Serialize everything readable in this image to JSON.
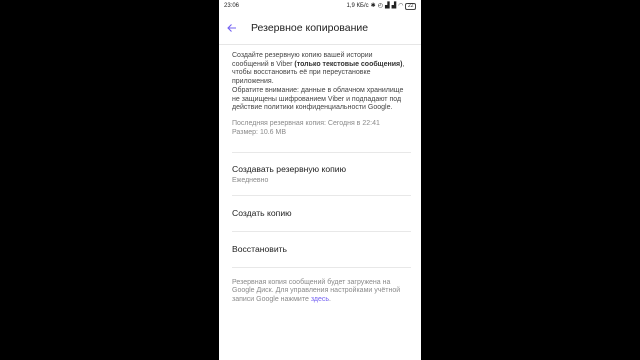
{
  "status_bar": {
    "time": "23:06",
    "net_speed": "1,9 КБ/с",
    "battery": "22"
  },
  "app_bar": {
    "title": "Резервное копирование",
    "back_icon": "back-arrow-icon",
    "accent": "#7360f2"
  },
  "description": {
    "part1": "Создайте резервную копию вашей истории сообщений в Viber ",
    "bold": "(только текстовые сообщения)",
    "part2": ", чтобы восстановить её при переустановке приложения.",
    "note": "Обратите внимание: данные в облачном хранилище не защищены шифрованием Viber и подпадают под действие политики конфиденциальности Google."
  },
  "backup_info": {
    "last_backup": "Последняя резервная копия: Сегодня в 22:41",
    "size": "Размер: 10.6 MB"
  },
  "settings": {
    "create_backup_title": "Создавать резервную копию",
    "create_backup_value": "Ежедневно",
    "make_copy": "Создать копию",
    "restore": "Восстановить"
  },
  "footer": {
    "text": "Резервная копия сообщений будет загружена на Google Диск. Для управления настройками учётной записи Google нажмите ",
    "link": "здесь",
    "end": "."
  }
}
